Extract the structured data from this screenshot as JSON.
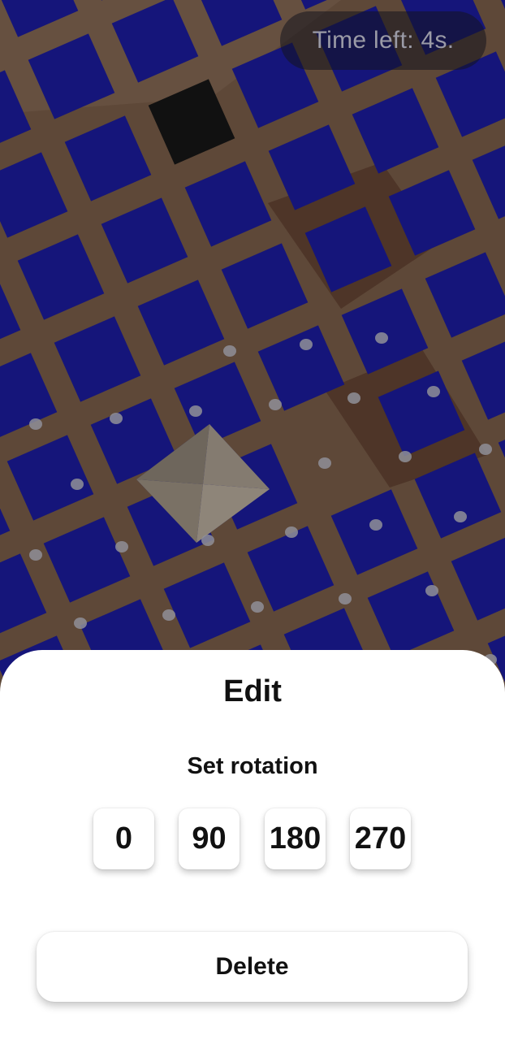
{
  "hud": {
    "timer_text": "Time left: 4s."
  },
  "sheet": {
    "title": "Edit",
    "rotation_label": "Set rotation",
    "rotation_options": [
      "0",
      "90",
      "180",
      "270"
    ],
    "delete_label": "Delete"
  },
  "colors": {
    "board": "#5a4535",
    "tile": "#15157a",
    "tile_black": "#111111",
    "tile_magenta": "#8e1a7c",
    "piece": "#7e7468",
    "sheet_bg": "#ffffff"
  }
}
